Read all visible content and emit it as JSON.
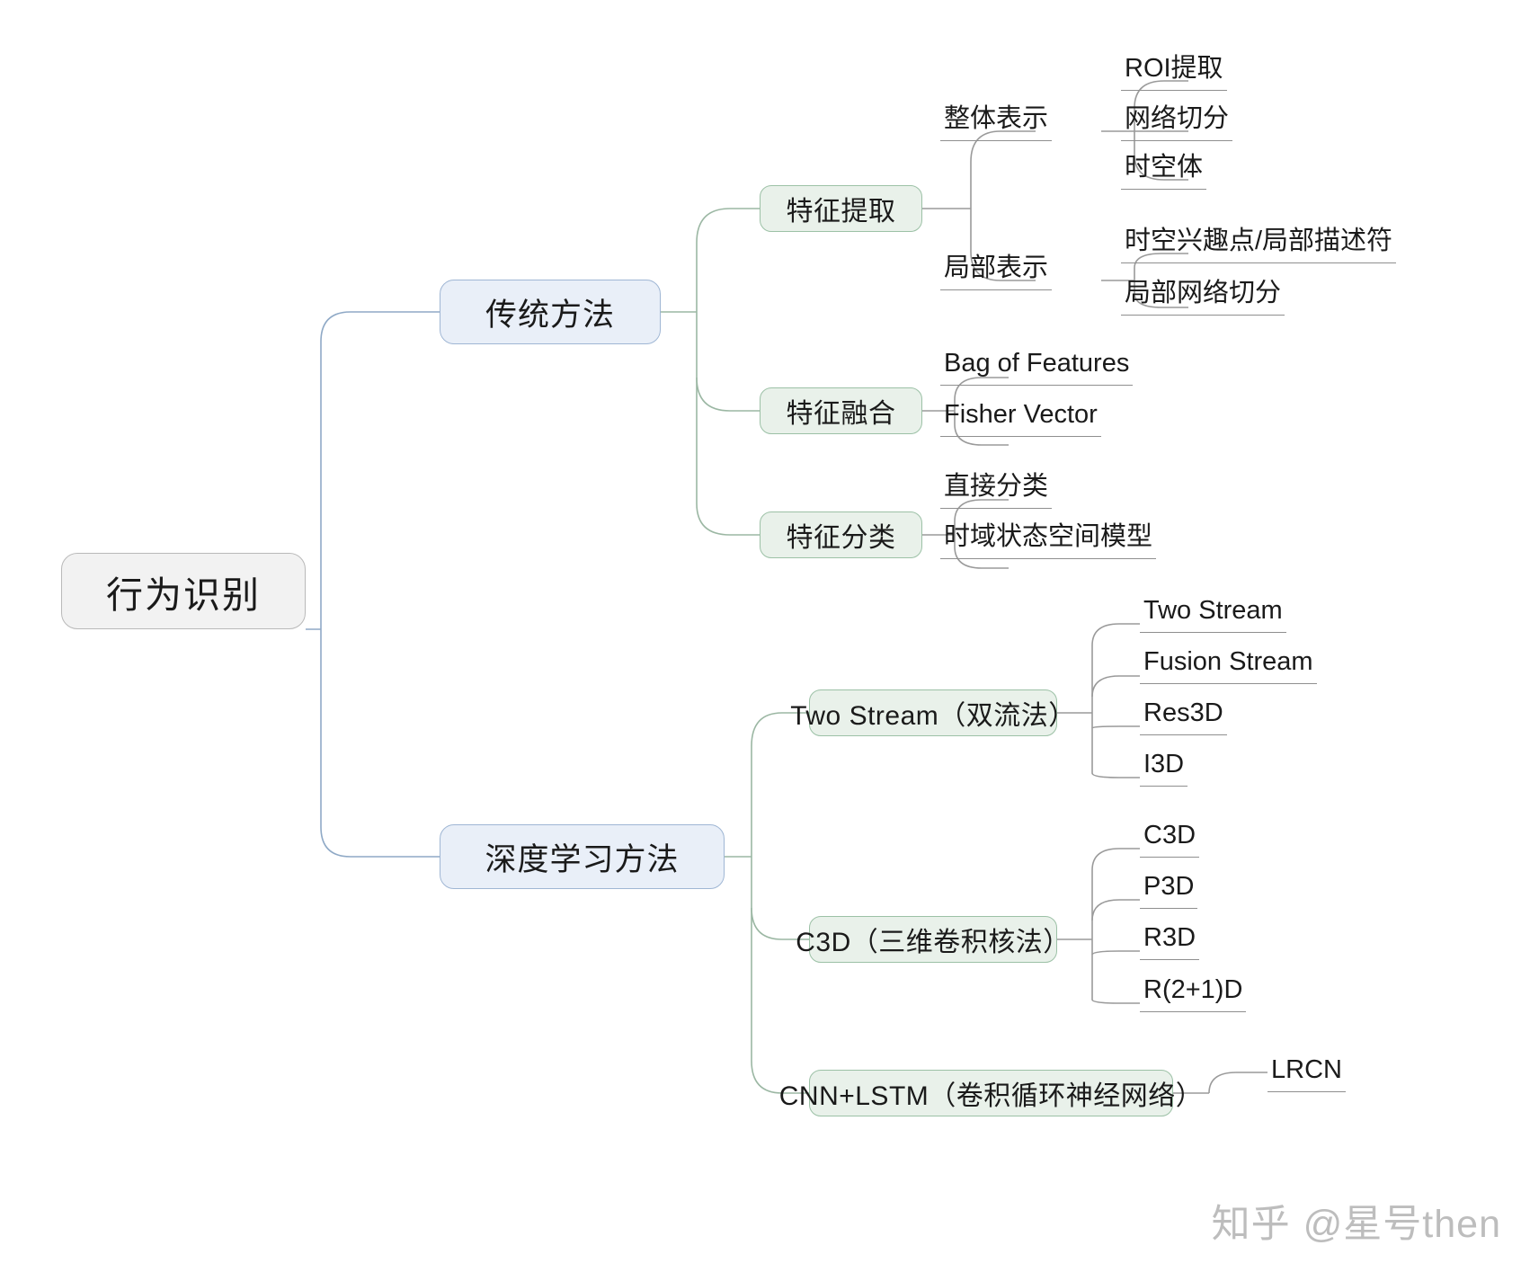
{
  "diagram": {
    "type": "mindmap",
    "root": {
      "label": "行为识别"
    },
    "branches": [
      {
        "label": "传统方法",
        "children": [
          {
            "label": "特征提取",
            "children": [
              {
                "label": "整体表示",
                "children": [
                  {
                    "label": "ROI提取"
                  },
                  {
                    "label": "网络切分"
                  },
                  {
                    "label": "时空体"
                  }
                ]
              },
              {
                "label": "局部表示",
                "children": [
                  {
                    "label": "时空兴趣点/局部描述符"
                  },
                  {
                    "label": "局部网络切分"
                  }
                ]
              }
            ]
          },
          {
            "label": "特征融合",
            "children": [
              {
                "label": "Bag of Features"
              },
              {
                "label": "Fisher Vector"
              }
            ]
          },
          {
            "label": "特征分类",
            "children": [
              {
                "label": "直接分类"
              },
              {
                "label": "时域状态空间模型"
              }
            ]
          }
        ]
      },
      {
        "label": "深度学习方法",
        "children": [
          {
            "label": "Two Stream（双流法）",
            "children": [
              {
                "label": "Two Stream"
              },
              {
                "label": "Fusion Stream"
              },
              {
                "label": "Res3D"
              },
              {
                "label": "I3D"
              }
            ]
          },
          {
            "label": "C3D（三维卷积核法）",
            "children": [
              {
                "label": "C3D"
              },
              {
                "label": "P3D"
              },
              {
                "label": "R3D"
              },
              {
                "label": "R(2+1)D"
              }
            ]
          },
          {
            "label": "CNN+LSTM（卷积循环神经网络）",
            "children": [
              {
                "label": "LRCN"
              }
            ]
          }
        ]
      }
    ]
  },
  "watermark": {
    "site": "知乎",
    "handle": "@星号then"
  },
  "colors": {
    "root_fill": "#f2f2f2",
    "root_border": "#b9b9b9",
    "level1_fill": "#e9eff8",
    "level1_border": "#9fb6d4",
    "level2_fill": "#e9f1ea",
    "level2_border": "#9cc1a6",
    "edge_blue": "#8fa9c6",
    "edge_green": "#9bb7a3",
    "edge_gray": "#9a9a9a",
    "text": "#1a1a1a",
    "watermark": "#bdbdbd",
    "background": "#ffffff"
  }
}
